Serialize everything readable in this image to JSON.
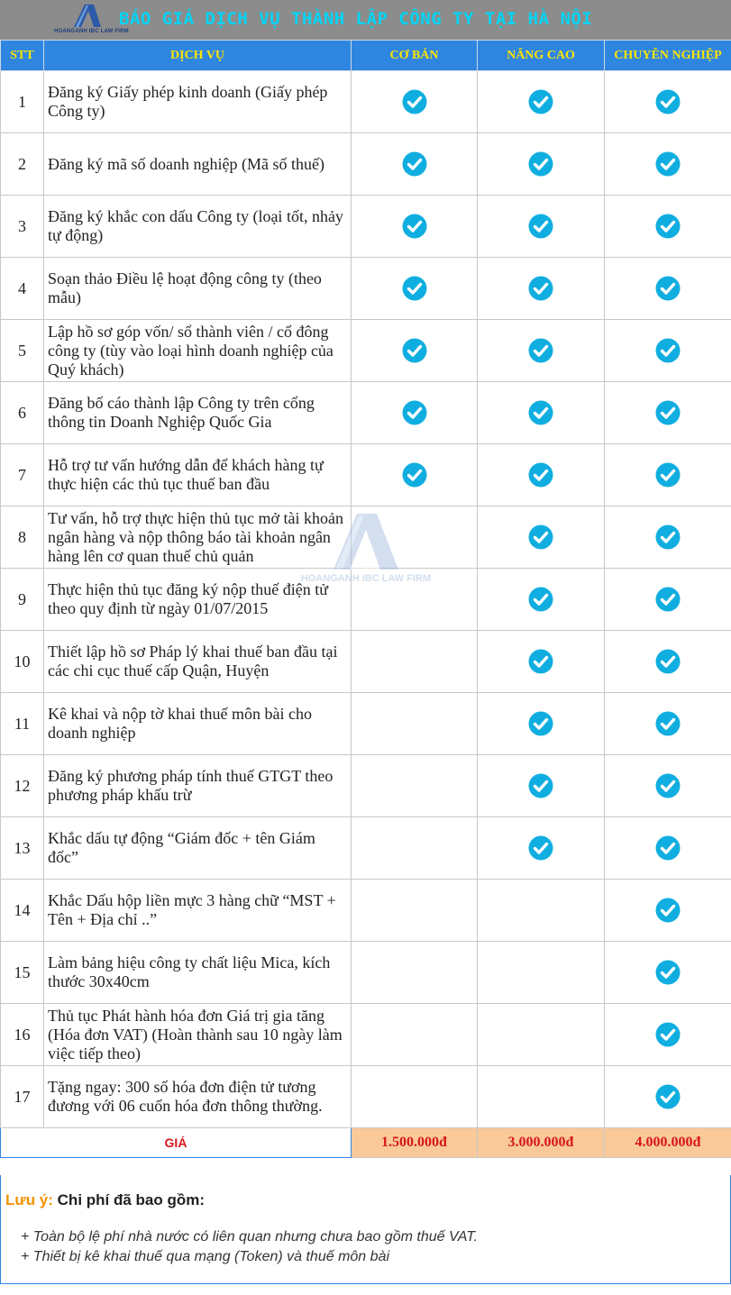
{
  "header": {
    "title": "BÁO GIÁ DỊCH VỤ THÀNH LẬP CÔNG TY TẠI HÀ NỘI",
    "logo_text": "HOANGANH IBC LAW FIRM"
  },
  "columns": {
    "stt": "STT",
    "service": "DỊCH VỤ",
    "basic": "CƠ BẢN",
    "advanced": "NÂNG CAO",
    "professional": "CHUYÊN NGHIỆP"
  },
  "rows": [
    {
      "stt": "1",
      "service": "Đăng ký Giấy phép kinh doanh (Giấy phép Công ty)",
      "basic": true,
      "advanced": true,
      "professional": true
    },
    {
      "stt": "2",
      "service": "Đăng ký mã số doanh nghiệp (Mã số thuế)",
      "basic": true,
      "advanced": true,
      "professional": true
    },
    {
      "stt": "3",
      "service": "Đăng ký khắc con dấu Công ty (loại tốt, nhảy tự động)",
      "basic": true,
      "advanced": true,
      "professional": true
    },
    {
      "stt": "4",
      "service": "Soạn thảo Điều lệ hoạt động công ty (theo mẫu)",
      "basic": true,
      "advanced": true,
      "professional": true
    },
    {
      "stt": "5",
      "service": "Lập hồ sơ góp vốn/ sổ thành viên / cổ đông công ty (tùy vào loại hình doanh nghiệp của Quý khách)",
      "basic": true,
      "advanced": true,
      "professional": true
    },
    {
      "stt": "6",
      "service": "Đăng bố cáo thành lập Công ty trên cổng thông tin Doanh Nghiệp Quốc Gia",
      "basic": true,
      "advanced": true,
      "professional": true
    },
    {
      "stt": "7",
      "service": "Hỗ trợ tư vấn hướng dẫn để khách hàng tự thực hiện các thủ tục thuế ban đầu",
      "basic": true,
      "advanced": true,
      "professional": true
    },
    {
      "stt": "8",
      "service": "Tư vấn, hỗ trợ thực hiện thủ tục mở tài khoản ngân hàng và nộp thông báo tài khoản ngân hàng lên cơ quan thuế chủ quản",
      "basic": false,
      "advanced": true,
      "professional": true
    },
    {
      "stt": "9",
      "service": "Thực hiện thủ tục đăng ký nộp thuế điện tử theo quy định từ ngày 01/07/2015",
      "basic": false,
      "advanced": true,
      "professional": true
    },
    {
      "stt": "10",
      "service": "Thiết lập hồ sơ Pháp lý khai thuế ban đầu tại các chi cục thuế cấp Quận, Huyện",
      "basic": false,
      "advanced": true,
      "professional": true
    },
    {
      "stt": "11",
      "service": "Kê khai và nộp tờ khai thuế môn bài cho doanh nghiệp",
      "basic": false,
      "advanced": true,
      "professional": true
    },
    {
      "stt": "12",
      "service": "Đăng ký phương pháp tính thuế GTGT theo phương pháp khấu trừ",
      "basic": false,
      "advanced": true,
      "professional": true
    },
    {
      "stt": "13",
      "service": "Khắc dấu tự động “Giám đốc + tên Giám đốc”",
      "basic": false,
      "advanced": true,
      "professional": true
    },
    {
      "stt": "14",
      "service": "Khắc Dấu hộp liền mực 3 hàng chữ “MST + Tên + Địa chỉ ..”",
      "basic": false,
      "advanced": false,
      "professional": true
    },
    {
      "stt": "15",
      "service": "Làm bảng hiệu công ty chất liệu Mica, kích thước 30x40cm",
      "basic": false,
      "advanced": false,
      "professional": true
    },
    {
      "stt": "16",
      "service": "Thủ tục Phát hành hóa đơn Giá trị gia tăng (Hóa đơn VAT) (Hoàn thành sau 10 ngày làm việc tiếp theo)",
      "basic": false,
      "advanced": false,
      "professional": true
    },
    {
      "stt": "17",
      "service": "Tặng ngay: 300 số hóa đơn điện tử tương đương với 06 cuốn hóa đơn thông thường.",
      "basic": false,
      "advanced": false,
      "professional": true
    }
  ],
  "price": {
    "label": "GIÁ",
    "basic": "1.500.000đ",
    "advanced": "3.000.000đ",
    "professional": "4.000.000đ"
  },
  "watermark_text": "HOANGANH IBC LAW FIRM",
  "notes": {
    "label": "Lưu ý:",
    "heading": "Chi phí đã bao gồm:",
    "items": [
      "+ Toàn bộ lệ phí nhà nước có liên quan nhưng chưa bao gồm thuế VAT.",
      "+ Thiết bị kê khai thuế qua mạng (Token) và thuế môn bài"
    ]
  },
  "colors": {
    "header_bg": "#2f86e0",
    "header_text": "#ffe400",
    "title_text": "#00d4f5",
    "check": "#10aee0",
    "price_bg": "#f9c99a",
    "price_text": "#d8161b",
    "note_label": "#f39200"
  }
}
